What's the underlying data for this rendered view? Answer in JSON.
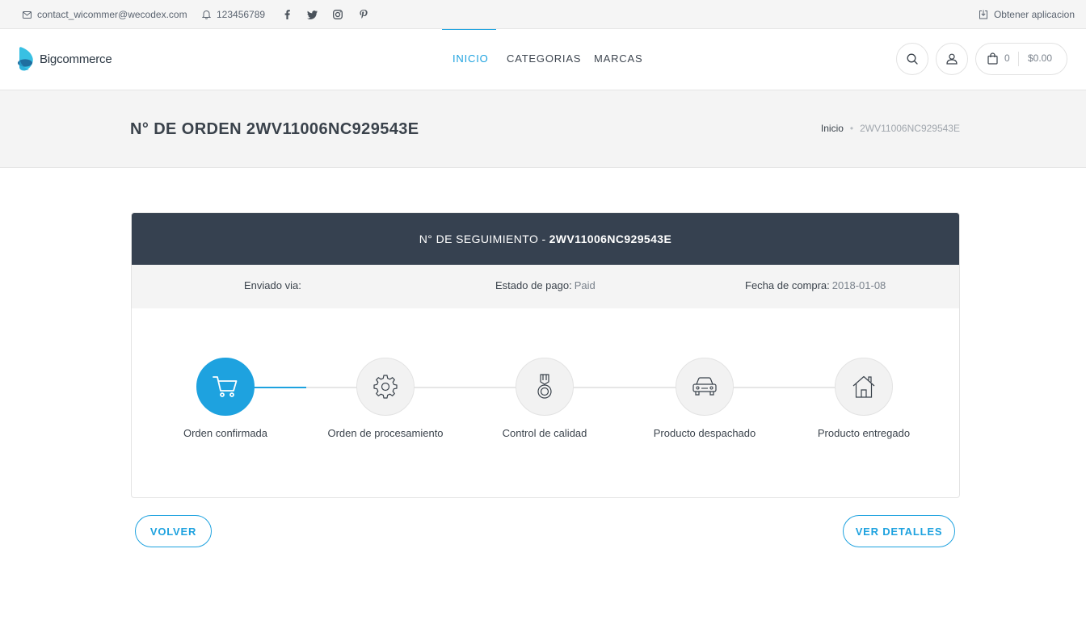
{
  "topbar": {
    "email": "contact_wicommer@wecodex.com",
    "phone": "123456789",
    "social": [
      "facebook-icon",
      "twitter-icon",
      "instagram-icon",
      "pinterest-icon"
    ],
    "app_link": "Obtener aplicacion"
  },
  "header": {
    "logo_text": "Bigcommerce",
    "nav": [
      "INICIO",
      "CATEGORIAS",
      "MARCAS"
    ],
    "active_nav": "INICIO",
    "cart_count": "0",
    "cart_total": "$0.00"
  },
  "page": {
    "title": "N° DE ORDEN 2WV11006NC929543E",
    "breadcrumb_home": "Inicio",
    "breadcrumb_separator": "•",
    "breadcrumb_current": "2WV11006NC929543E"
  },
  "tracking": {
    "heading_label": "N° DE SEGUIMIENTO -",
    "heading_code": "2WV11006NC929543E",
    "shipped_label": "Enviado via:",
    "shipped_value": "",
    "payment_label": "Estado de pago:",
    "payment_value": "Paid",
    "date_label": "Fecha de compra:",
    "date_value": "2018-01-08",
    "steps": [
      {
        "label": "Orden confirmada",
        "icon": "cart-icon",
        "active": true
      },
      {
        "label": "Orden de procesamiento",
        "icon": "gear-icon",
        "active": false
      },
      {
        "label": "Control de calidad",
        "icon": "medal-icon",
        "active": false
      },
      {
        "label": "Producto despachado",
        "icon": "car-icon",
        "active": false
      },
      {
        "label": "Producto entregado",
        "icon": "house-icon",
        "active": false
      }
    ]
  },
  "actions": {
    "back": "VOLVER",
    "details": "VER DETALLES"
  },
  "colors": {
    "accent": "#1ea2df",
    "card_header": "#364150"
  }
}
